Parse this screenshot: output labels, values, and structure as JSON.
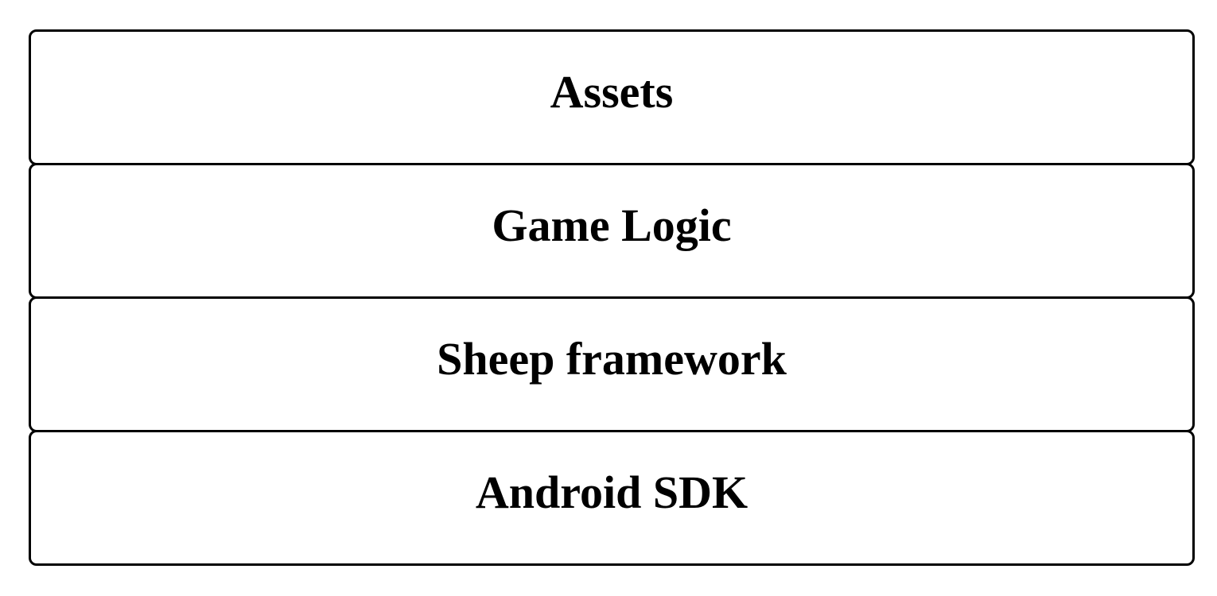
{
  "diagram": {
    "layers": [
      {
        "label": "Assets"
      },
      {
        "label": "Game Logic"
      },
      {
        "label": "Sheep framework"
      },
      {
        "label": "Android SDK"
      }
    ]
  }
}
